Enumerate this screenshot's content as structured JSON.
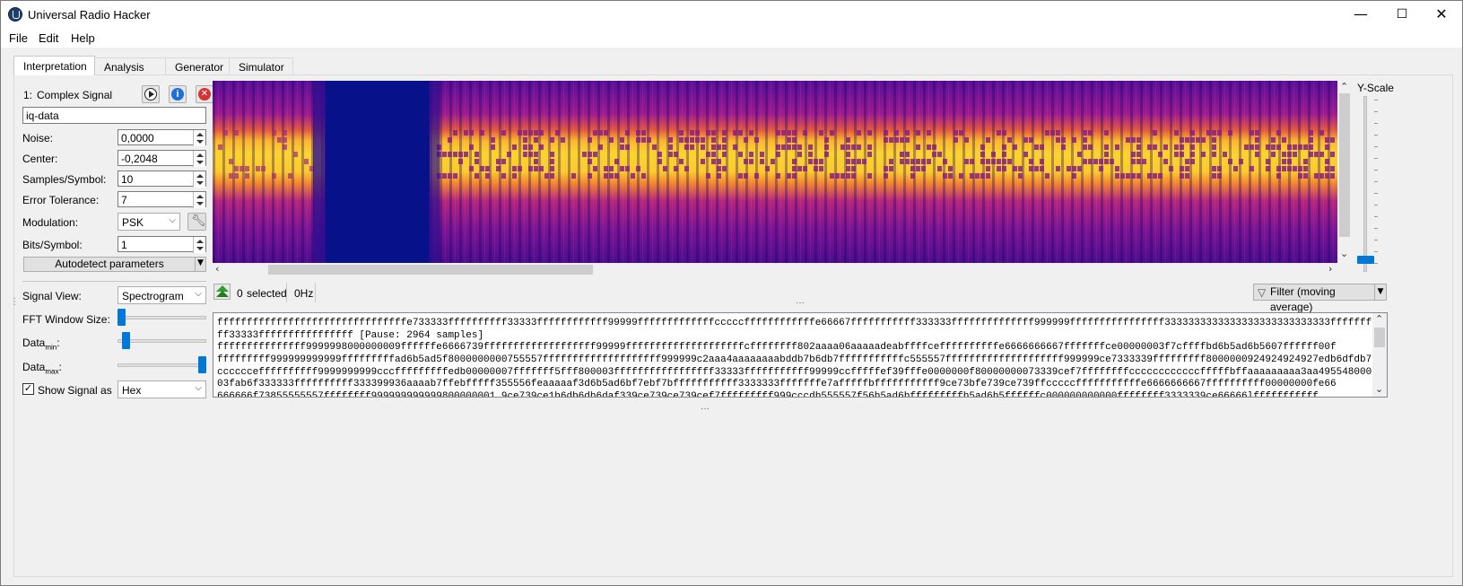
{
  "window": {
    "title": "Universal Radio Hacker",
    "minimize": "—",
    "maximize": "☐",
    "close": "✕"
  },
  "menu": {
    "file": "File",
    "edit": "Edit",
    "help": "Help"
  },
  "tabs": [
    "Interpretation",
    "Analysis",
    "Generator",
    "Simulator"
  ],
  "signal": {
    "index": "1:",
    "title": "Complex Signal",
    "name": "iq-data",
    "noise_label": "Noise:",
    "noise": "0,0000",
    "center_label": "Center:",
    "center": "-0,2048",
    "sps_label": "Samples/Symbol:",
    "sps": "10",
    "tolerance_label": "Error Tolerance:",
    "tolerance": "7",
    "modulation_label": "Modulation:",
    "modulation": "PSK",
    "bits_label": "Bits/Symbol:",
    "bits": "1",
    "autodetect": "Autodetect parameters",
    "view_label": "Signal View:",
    "view": "Spectrogram",
    "fft_label": "FFT Window Size:",
    "datamin_label": "Data",
    "datamin_sub": "min",
    "datamin_colon": ":",
    "datamax_label": "Data",
    "datamax_sub": "max",
    "datamax_colon": ":",
    "show_label": "Show Signal as",
    "show_value": "Hex",
    "show_checked": true
  },
  "sliders": {
    "fft": 0.0,
    "datamin": 0.06,
    "datamax": 1.0,
    "yscale": 0.95
  },
  "spectro_toolbar": {
    "selected": "0",
    "selected_label": "selected",
    "freq": "0Hz",
    "filter": "Filter (moving average)"
  },
  "yscale_label": "Y-Scale",
  "colors": {
    "accent": "#0078d7",
    "spectro_low": "#07128a",
    "spectro_mid": "#b01e8c",
    "spectro_high": "#fcce2c"
  },
  "hex_lines": [
    "ffffffffffffffffffffffffffffffffe733333ffffffffff33333ffffffffffff99999fffffffffffffcccccffffffffffffe66667fffffffffff333333ffffffffffffff999999ffffffffffffffff3333333333333333333333333333ffffffff",
    "ff33333ffffffffffffffff [Pause: 2964 samples]",
    "fffffffffffffff9999998000000009ffffffe6666739fffffffffffffffffff99999ffffffffffffffffffffcffffffff802aaaa06aaaaadeabffffceffffffffffe6666666667fffffffce00000003f7cffffbd6b5ad6b5607ffffff00f",
    "fffffffff999999999999fffffffffad6b5ad5f8000000000755557ffffffffffffffffffff999999c2aaa4aaaaaaaabddb7b6db7fffffffffffc555557ffffffffffffffffffff999999ce7333339fffffffff8000000924924924927edb6dfdb7",
    "cccccceffffffffff9999999999cccfffffffffedb00000007fffffff5fff800003fffffffffffffffff33333fffffffffff99999ccfffffef39fffe0000000f80000000073339cef7ffffffffccccccccccccfffffbffaaaaaaaaa3aa495548000",
    "03fab6f333333ffffffffff333399936aaaab7ffebfffff355556feaaaaaf3d6b5ad6bf7ebf7bfffffffffff3333333fffffffe7afffffbfffffffffff9ce73bfe739ce739ffcccccfffffffffffe6666666667ffffffffff00000000fe66",
    "666666f73855555557ffffffff999999999999800000001 9ce739ce1b6db6db6daf339ce739ce739cef7fffffffff999cccdb555557f56b5ad6bfffffffffb5ad6b5ffffffc000000000000ffffffff3333339ce66666lfffffffffff"
  ]
}
